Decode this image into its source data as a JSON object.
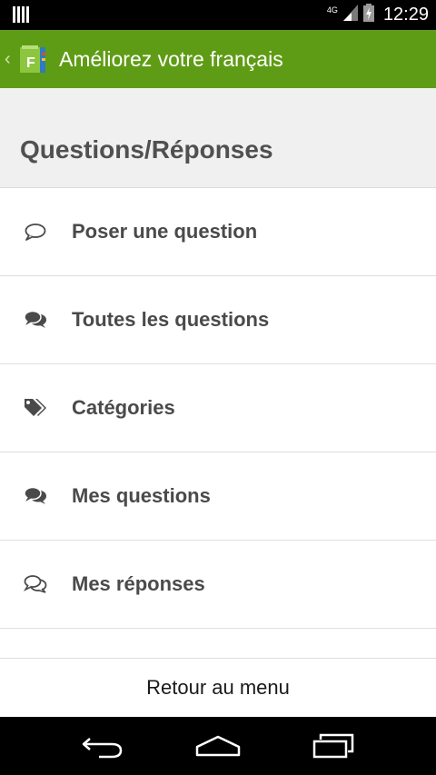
{
  "status_bar": {
    "network": "4G",
    "time": "12:29"
  },
  "action_bar": {
    "logo_letter": "F",
    "title": "Améliorez votre français"
  },
  "section": {
    "title": "Questions/Réponses"
  },
  "menu": [
    {
      "icon": "speech-bubble-outline-icon",
      "label": "Poser une question"
    },
    {
      "icon": "chat-bubbles-icon",
      "label": "Toutes les questions"
    },
    {
      "icon": "tags-icon",
      "label": "Catégories"
    },
    {
      "icon": "chat-bubbles-icon",
      "label": "Mes questions"
    },
    {
      "icon": "chat-bubbles-outline-icon",
      "label": "Mes réponses"
    }
  ],
  "footer": {
    "return_label": "Retour au menu"
  },
  "colors": {
    "action_bar": "#5f9c15",
    "header_bg": "#f0f0f0",
    "text_dark": "#4a4a4a"
  }
}
